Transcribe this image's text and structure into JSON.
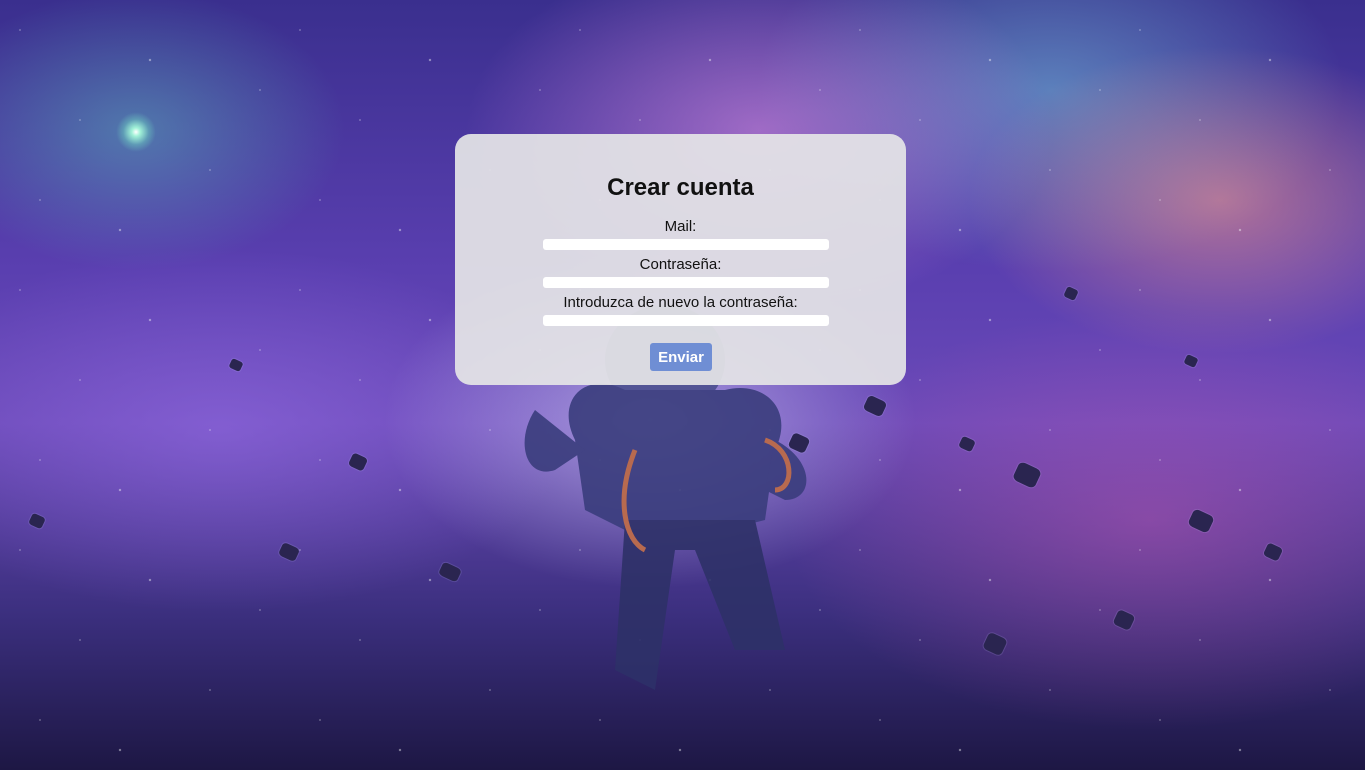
{
  "form": {
    "title": "Crear cuenta",
    "fields": [
      {
        "label": "Mail:",
        "value": ""
      },
      {
        "label": "Contraseña:",
        "value": ""
      },
      {
        "label": "Introduzca de nuevo la contraseña:",
        "value": ""
      }
    ],
    "submit_label": "Enviar"
  },
  "colors": {
    "card_background": "#e4e4e6",
    "submit_button": "#6f8ed4",
    "input_background": "#ffffff"
  }
}
